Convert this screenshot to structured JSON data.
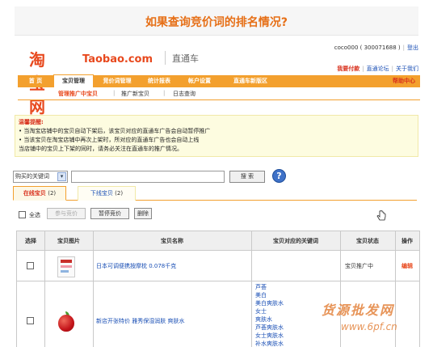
{
  "page_title": "如果查询竞价词的排名情况?",
  "header": {
    "logo_cn": "淘宝网",
    "logo_en": "Taobao.com",
    "product": "直通车",
    "user": "coco000 ( 300071688 )",
    "logout": "登出",
    "recharge": "我要付款",
    "forum": "直通论坛",
    "about": "关于我们"
  },
  "nav": {
    "items": [
      "首 页",
      "宝贝管理",
      "竞价词管理",
      "统计报表",
      "帐户设置",
      "直通车新版区"
    ],
    "help": "帮助中心"
  },
  "subnav": {
    "items": [
      "管理推广中宝贝",
      "推广新宝贝",
      "日志查询"
    ]
  },
  "notice": {
    "title": "温馨提醒:",
    "lines": [
      "当淘宝店铺中的宝贝自动下架后，该宝贝对应的直通车广告会自动暂停推广",
      "当该宝贝在淘宝店铺中再次上架时，所对应的直通车广告也会自动上线",
      "当店铺中的宝贝上下架的同时，请务必关注在直通车的推广情况。"
    ]
  },
  "search": {
    "select_value": "购买的关键词",
    "input_value": "",
    "button": "搜 索",
    "help": "?"
  },
  "tabs": {
    "active_label": "在线宝贝",
    "active_count": "(2)",
    "inactive_label": "下线宝贝",
    "inactive_count": "(2)"
  },
  "toolbar": {
    "select_all": "全选",
    "btn_join": "参与竞价",
    "btn_pause": "暂停竞价",
    "btn_delete": "删除"
  },
  "table": {
    "headers": [
      "选择",
      "宝贝图片",
      "宝贝名称",
      "宝贝对应的关键词",
      "宝贝状态",
      "操作"
    ],
    "rows": [
      {
        "name": "日本可调便携按摩枕 0.078千克",
        "keywords": [],
        "status": "宝贝推广中",
        "action": "编辑"
      },
      {
        "name": "新店开张特价 雅秀保湿润肤 爽肤水",
        "keywords": [
          "芦荟",
          "美白",
          "美白爽肤水",
          "女士",
          "爽肤水",
          "芦荟爽肤水",
          "女士爽肤水",
          "补水爽肤水"
        ],
        "status": "",
        "action": ""
      }
    ]
  },
  "watermark": {
    "top": "货源批发网",
    "bottom": "www.6pf.cn"
  }
}
